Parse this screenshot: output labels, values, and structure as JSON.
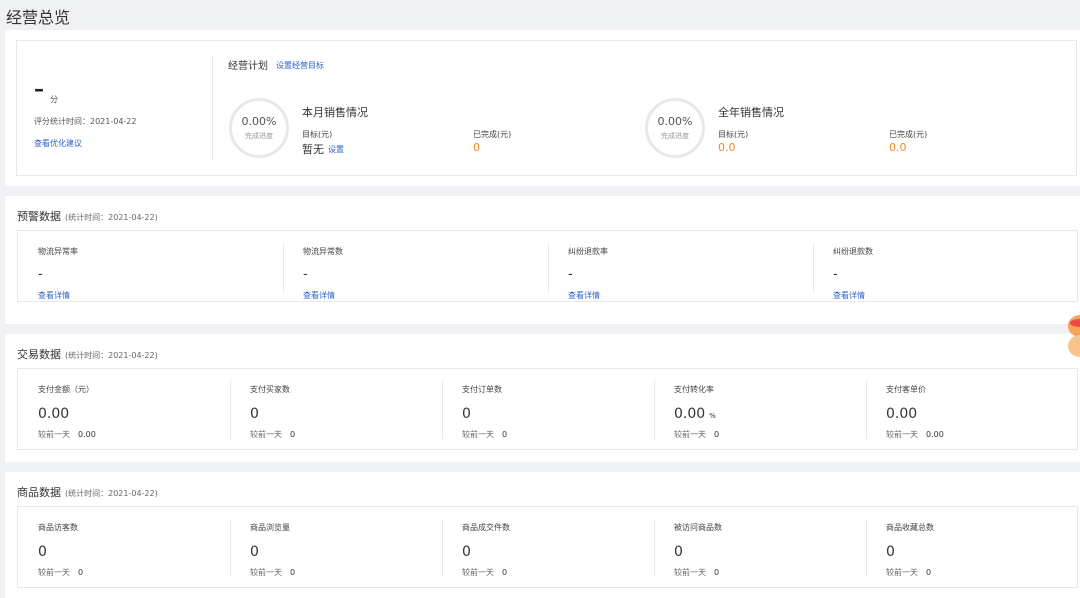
{
  "page_title": "经营总览",
  "score": {
    "value": "–",
    "unit": "分",
    "stat_time": "评分统计时间：2021-04-22",
    "link": "查看优化建议"
  },
  "plan": {
    "title": "经营计划",
    "set_link": "设置经营目标",
    "month": {
      "title": "本月销售情况",
      "ring_pct": "0.00%",
      "ring_sub": "完成进度",
      "target_label": "目标(元)",
      "target_value": "暂无",
      "set_link": "设置",
      "done_label": "已完成(元)",
      "done_value": "0"
    },
    "year": {
      "title": "全年销售情况",
      "ring_pct": "0.00%",
      "ring_sub": "完成进度",
      "target_label": "目标(元)",
      "target_value": "0.0",
      "done_label": "已完成(元)",
      "done_value": "0.0"
    }
  },
  "warning": {
    "title": "预警数据",
    "time": "(统计时间：2021-04-22)",
    "items": [
      {
        "label": "物流异常率",
        "value": "-",
        "link": "查看详情"
      },
      {
        "label": "物流异常数",
        "value": "-",
        "link": "查看详情"
      },
      {
        "label": "纠纷退款率",
        "value": "-",
        "link": "查看详情"
      },
      {
        "label": "纠纷退款数",
        "value": "-",
        "link": "查看详情"
      }
    ]
  },
  "trade": {
    "title": "交易数据",
    "time": "(统计时间：2021-04-22)",
    "items": [
      {
        "label": "支付金额（元）",
        "value": "0.00",
        "unit": "",
        "cmp_label": "较前一天",
        "cmp_value": "0.00"
      },
      {
        "label": "支付买家数",
        "value": "0",
        "unit": "",
        "cmp_label": "较前一天",
        "cmp_value": "0"
      },
      {
        "label": "支付订单数",
        "value": "0",
        "unit": "",
        "cmp_label": "较前一天",
        "cmp_value": "0"
      },
      {
        "label": "支付转化率",
        "value": "0.00",
        "unit": "%",
        "cmp_label": "较前一天",
        "cmp_value": "0"
      },
      {
        "label": "支付客单价",
        "value": "0.00",
        "unit": "",
        "cmp_label": "较前一天",
        "cmp_value": "0.00"
      }
    ]
  },
  "goods": {
    "title": "商品数据",
    "time": "(统计时间：2021-04-22)",
    "items": [
      {
        "label": "商品访客数",
        "value": "0",
        "cmp_label": "较前一天",
        "cmp_value": "0"
      },
      {
        "label": "商品浏览量",
        "value": "0",
        "cmp_label": "较前一天",
        "cmp_value": "0"
      },
      {
        "label": "商品成交件数",
        "value": "0",
        "cmp_label": "较前一天",
        "cmp_value": "0"
      },
      {
        "label": "被访问商品数",
        "value": "0",
        "cmp_label": "较前一天",
        "cmp_value": "0"
      },
      {
        "label": "商品收藏总数",
        "value": "0",
        "cmp_label": "较前一天",
        "cmp_value": "0"
      }
    ]
  }
}
